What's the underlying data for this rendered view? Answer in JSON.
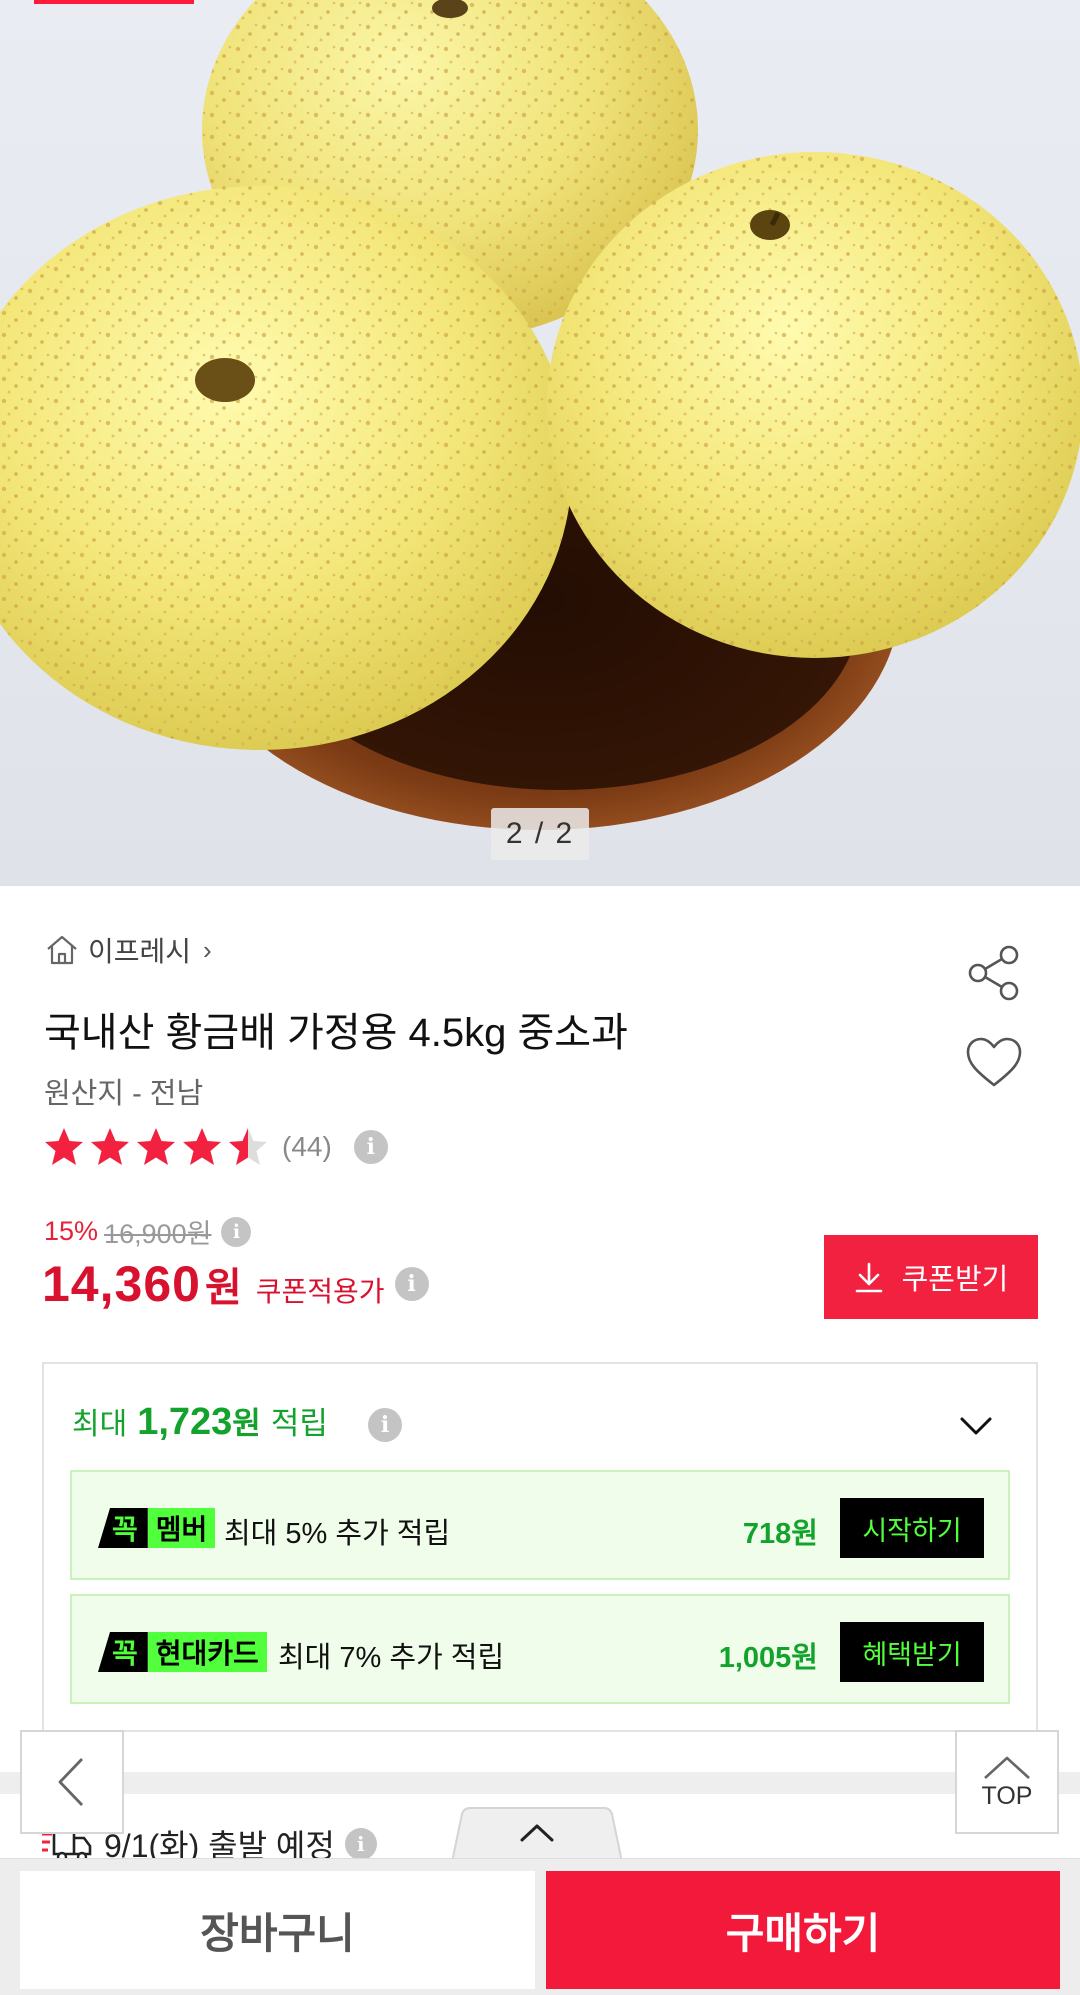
{
  "colors": {
    "accent": "#f2193a",
    "price_red": "#d8112e",
    "reward_green": "#13a32c",
    "neon_green": "#52ff3c",
    "promo_bg": "#f0fdea"
  },
  "gallery": {
    "page_indicator": "2 / 2",
    "current_index": 2,
    "total": 2
  },
  "product": {
    "store_icon": "home-icon",
    "store_name": "이프레시",
    "store_chevron": "›",
    "title": "국내산 황금배 가정용 4.5kg 중소과",
    "origin": "원산지 - 전남",
    "rating": 4.5,
    "rating_max": 5,
    "review_count": "(44)",
    "share_icon": "share-icon",
    "wish_icon": "heart-icon"
  },
  "price": {
    "discount_rate": "15%",
    "original_price": "16,900원",
    "sale_price": "14,360",
    "sale_unit": "원",
    "coupon_applied_label": "쿠폰적용가",
    "coupon_button_label": "쿠폰받기",
    "info_glyph": "i"
  },
  "rewards": {
    "label": "최대",
    "amount": "1,723",
    "unit": "원",
    "suffix": "적립",
    "toggle_icon": "chevron-down-icon",
    "promos": [
      {
        "badge_prefix": "꼭",
        "badge_name": "멤버",
        "description": "최대 5% 추가 적립",
        "amount": "718원",
        "action": "시작하기"
      },
      {
        "badge_prefix": "꼭",
        "badge_name": "현대카드",
        "description": "최대 7% 추가 적립",
        "amount": "1,005원",
        "action": "혜택받기"
      }
    ]
  },
  "shipping": {
    "icon": "truck-icon",
    "text": "9/1(화) 출발 예정"
  },
  "floating": {
    "back_icon": "chevron-left-icon",
    "top_label": "TOP",
    "expand_icon": "chevron-up-icon"
  },
  "bottom_bar": {
    "cart_label": "장바구니",
    "buy_label": "구매하기"
  }
}
